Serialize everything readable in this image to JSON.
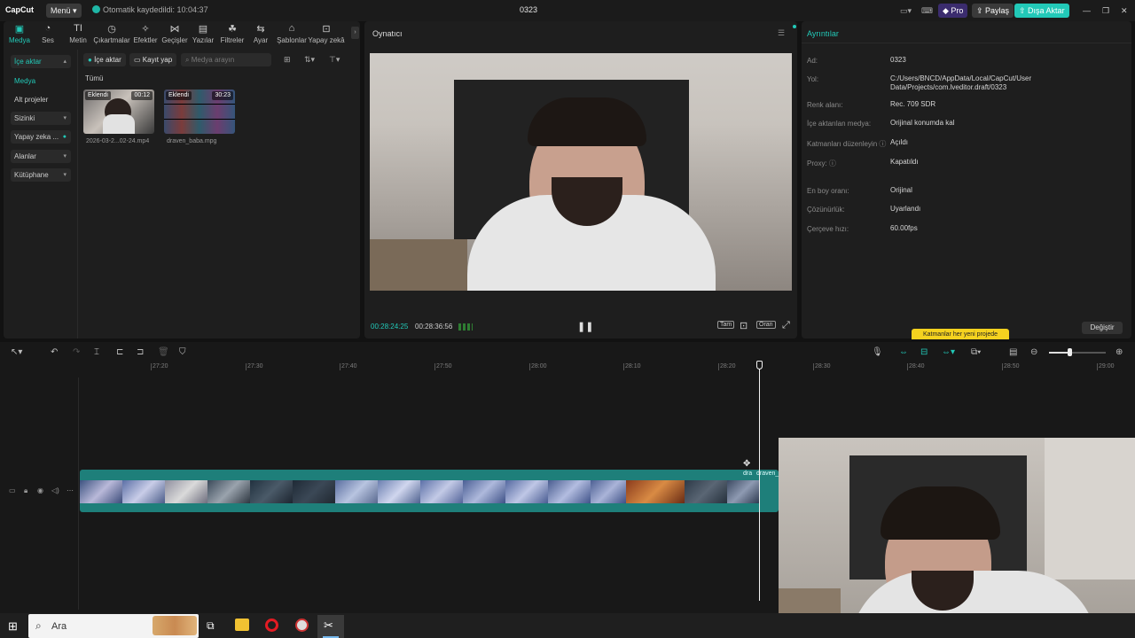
{
  "app": {
    "logo": "CapCut",
    "menu_label": "Menü",
    "autosave": "Otomatik kaydedildi: 10:04:37",
    "project_title": "0323",
    "pro_label": "Pro",
    "share_label": "Paylaş",
    "export_label": "Dışa Aktar"
  },
  "toolbar": {
    "items": [
      {
        "label": "Medya",
        "icon": "media-icon"
      },
      {
        "label": "Ses",
        "icon": "audio-icon"
      },
      {
        "label": "Metin",
        "icon": "text-icon"
      },
      {
        "label": "Çıkartmalar",
        "icon": "sticker-icon"
      },
      {
        "label": "Efektler",
        "icon": "effects-icon"
      },
      {
        "label": "Geçişler",
        "icon": "transitions-icon"
      },
      {
        "label": "Yazılar",
        "icon": "captions-icon"
      },
      {
        "label": "Filtreler",
        "icon": "filters-icon"
      },
      {
        "label": "Ayar",
        "icon": "adjust-icon"
      },
      {
        "label": "Şablonlar",
        "icon": "templates-icon"
      },
      {
        "label": "Yapay zekâ",
        "icon": "ai-icon"
      }
    ]
  },
  "sidebar": {
    "items": [
      {
        "label": "İçe aktar"
      },
      {
        "label": "Medya"
      },
      {
        "label": "Alt projeler"
      },
      {
        "label": "Sizinki"
      },
      {
        "label": "Yapay zeka ..."
      },
      {
        "label": "Alanlar"
      },
      {
        "label": "Kütüphane"
      }
    ]
  },
  "media": {
    "import_label": "İçe aktar",
    "record_label": "Kayıt yap",
    "search_placeholder": "Medya arayın",
    "filter_all": "Tümü",
    "clips": [
      {
        "badge": "Eklendi",
        "duration": "00:12",
        "name": "2026-03-2...02-24.mp4"
      },
      {
        "badge": "Eklendi",
        "duration": "30:23",
        "name": "draven_baba.mpg"
      }
    ]
  },
  "player": {
    "title": "Oynatıcı",
    "current_time": "00:28:24:25",
    "total_time": "00:28:36:56",
    "full_label": "Tam",
    "ratio_label": "Oran"
  },
  "details": {
    "title": "Ayrıntılar",
    "rows": [
      {
        "label": "Ad:",
        "value": "0323"
      },
      {
        "label": "Yol:",
        "value": "C:/Users/BNCD/AppData/Local/CapCut/User Data/Projects/com.lveditor.draft/0323"
      },
      {
        "label": "Renk alanı:",
        "value": "Rec. 709 SDR"
      },
      {
        "label": "İçe aktarılan medya:",
        "value": "Orijinal konumda kal"
      },
      {
        "label": "Katmanları düzenleyin",
        "value": "Açıldı"
      },
      {
        "label": "Proxy:",
        "value": "Kapatıldı"
      },
      {
        "label": "En boy oranı:",
        "value": "Orijinal"
      },
      {
        "label": "Çözünürlük:",
        "value": "Uyarlandı"
      },
      {
        "label": "Çerçeve hızı:",
        "value": "60.00fps"
      }
    ],
    "tooltip": "Katmanlar her yeni projede",
    "change_label": "Değiştir"
  },
  "timeline": {
    "ticks": [
      "27:20",
      "27:30",
      "27:40",
      "27:50",
      "28:00",
      "28:10",
      "28:20",
      "28:30",
      "28:40",
      "28:50",
      "29:00"
    ],
    "clip_labels": [
      "dra",
      "draven_b"
    ]
  },
  "taskbar": {
    "search_label": "Ara"
  },
  "colors": {
    "accent": "#22c9b8",
    "clip_track": "#1e7f7a",
    "tooltip": "#f5d21f"
  }
}
